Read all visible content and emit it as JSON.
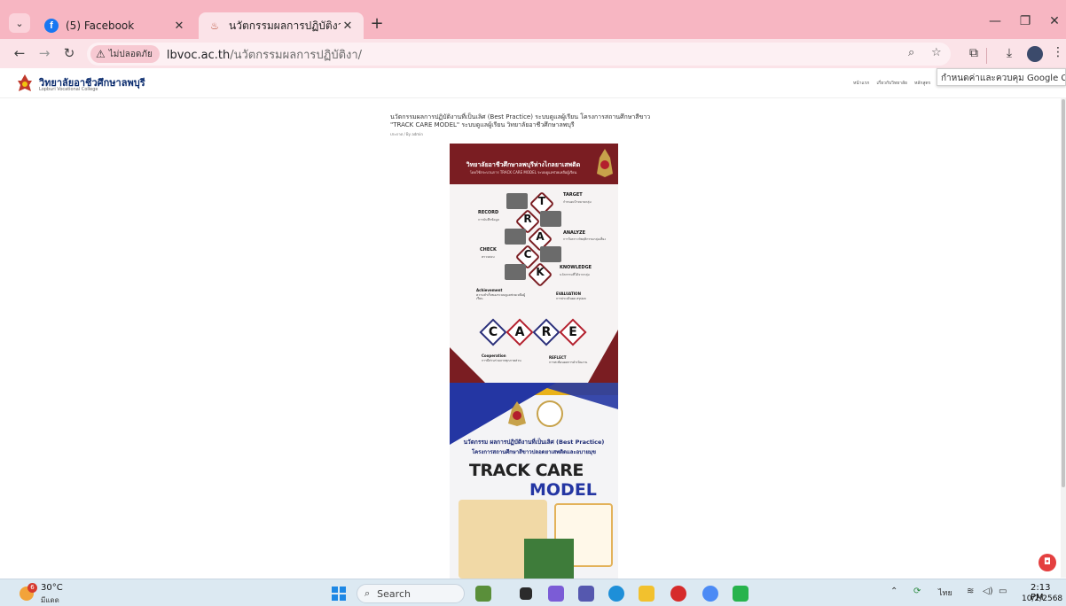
{
  "browser": {
    "tabs": [
      {
        "title": "(5) Facebook",
        "active": false,
        "favicon": "facebook-icon"
      },
      {
        "title": "นวัตกรรมผลการปฏิบัติงานที่เป็นเลิศ |",
        "active": true,
        "favicon": "site-icon"
      }
    ],
    "new_tab_label": "+",
    "window_controls": {
      "minimize": "—",
      "maximize": "❐",
      "close": "✕"
    },
    "security_chip": "ไม่ปลอดภัย",
    "url_host": "lbvoc.ac.th",
    "url_path": "/นวัตกรรมผลการปฏิบัติงา/",
    "tooltip": "กำหนดค่าและควบคุม Google Chrome"
  },
  "site": {
    "name": "วิทยาลัยอาชีวศึกษาลพบุรี",
    "subname": "Lopburi Vocational College",
    "nav": [
      "หน้าแรก",
      "เกี่ยวกับวิทยาลัย",
      "หลักสูตร"
    ],
    "nav_right": "TH EN"
  },
  "post": {
    "title": "นวัตกรรมผลการปฏิบัติงานที่เป็นเลิศ (Best Practice) ระบบดูแลผู้เรียน โครงการสถานศึกษาสีขาว \"TRACK CARE MODEL\" ระบบดูแลผู้เรียน วิทยาลัยอาชีวศึกษาลพบุรี",
    "meta": "ประกาศ / By admin"
  },
  "poster1": {
    "banner_title": "วิทยาลัยอาชีวศึกษาลพบุรีห่างไกลยาเสพติด",
    "banner_sub": "โดยใช้กระบวนการ TRACK CARE MODEL ระบบดูแลช่วยเหลือผู้เรียน",
    "track": [
      {
        "letter": "T",
        "label": "TARGET",
        "desc": "กำหนดเป้าหมายกลุ่ม"
      },
      {
        "letter": "R",
        "label": "RECORD",
        "desc": "การบันทึกข้อมูล"
      },
      {
        "letter": "A",
        "label": "ANALYZE",
        "desc": "การวิเคราะห์พฤติกรรมกลุ่มเสี่ยง"
      },
      {
        "letter": "C",
        "label": "CHECK",
        "desc": "ตรวจสอบ"
      },
      {
        "letter": "K",
        "label": "KNOWLEDGE",
        "desc": "นวัตกรรมที่ได้จากกลุ่ม"
      }
    ],
    "care": [
      {
        "letter": "C",
        "label": "Cooperation",
        "desc": "การมีส่วนร่วมจากทุกภาคส่วน"
      },
      {
        "letter": "A",
        "label": "Achievement",
        "desc": "ความสำเร็จของระบบดูแลช่วยเหลือผู้เรียน"
      },
      {
        "letter": "R",
        "label": "REFLECT",
        "desc": "การสะท้อนผลการดำเนินงาน"
      },
      {
        "letter": "E",
        "label": "EVALUATION",
        "desc": "การประเมินผล สรุปผล"
      }
    ]
  },
  "poster2": {
    "title1": "นวัตกรรม ผลการปฏิบัติงานที่เป็นเลิศ (Best Practice)",
    "title2": "โครงการสถานศึกษาสีขาวปลอดยาเสพติดและอบายมุข",
    "track": "TRACK CARE",
    "model": "MODEL"
  },
  "taskbar": {
    "weather_badge": "6",
    "temperature": "30°C",
    "weather_desc": "มีแดด",
    "search_label": "Search",
    "tray_lang": "ไทย",
    "time": "2:13 PM",
    "date": "10/2/2568"
  },
  "colors": {
    "tabstrip": "#f7b6c2",
    "toolbar": "#fbe3e8",
    "poster_maroon": "#7a1d22",
    "poster_blue": "#2436a3"
  }
}
